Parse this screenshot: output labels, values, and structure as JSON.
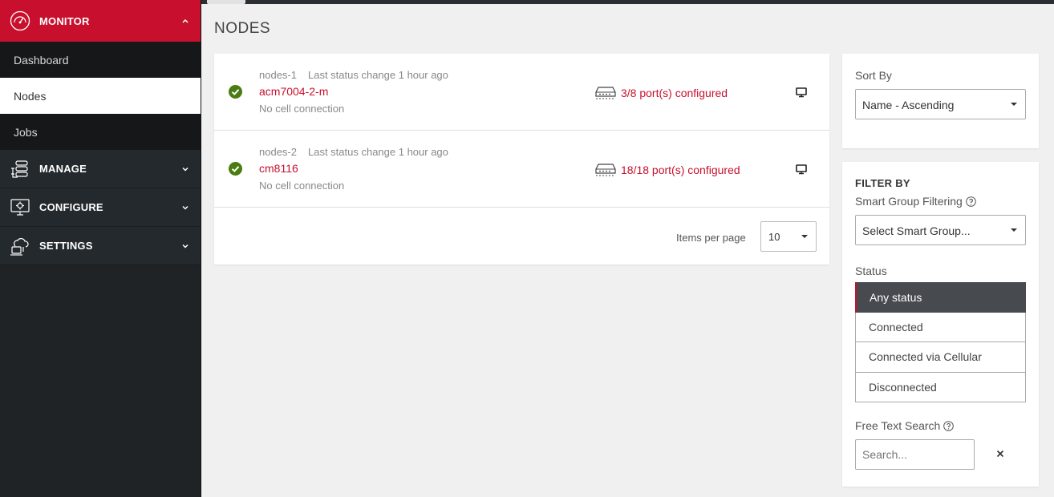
{
  "sidebar": {
    "monitor": {
      "label": "MONITOR",
      "items": [
        {
          "label": "Dashboard"
        },
        {
          "label": "Nodes"
        },
        {
          "label": "Jobs"
        }
      ]
    },
    "manage": {
      "label": "MANAGE"
    },
    "configure": {
      "label": "CONFIGURE"
    },
    "settings": {
      "label": "SETTINGS"
    }
  },
  "page": {
    "title": "NODES"
  },
  "nodes": [
    {
      "id": "nodes-1",
      "last_change": "Last status change 1 hour ago",
      "name": "acm7004-2-m",
      "cell": "No cell connection",
      "ports": "3/8 port(s) configured"
    },
    {
      "id": "nodes-2",
      "last_change": "Last status change 1 hour ago",
      "name": "cm8116",
      "cell": "No cell connection",
      "ports": "18/18 port(s) configured"
    }
  ],
  "pager": {
    "label": "Items per page",
    "value": "10"
  },
  "sort": {
    "label": "Sort By",
    "value": "Name - Ascending"
  },
  "filter": {
    "title": "FILTER BY",
    "smart_group_label": "Smart Group Filtering",
    "smart_group_value": "Select Smart Group...",
    "status_label": "Status",
    "status_options": [
      {
        "label": "Any status"
      },
      {
        "label": "Connected"
      },
      {
        "label": "Connected via Cellular"
      },
      {
        "label": "Disconnected"
      }
    ],
    "search_label": "Free Text Search",
    "search_placeholder": "Search..."
  },
  "colors": {
    "accent": "#c8102e",
    "sidebar": "#1f2326",
    "success": "#4a7c12"
  }
}
